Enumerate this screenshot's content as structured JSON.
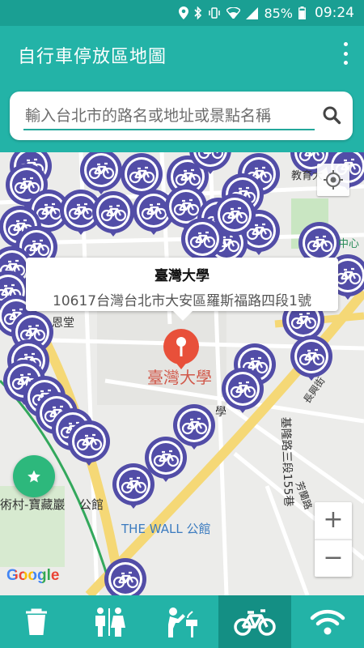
{
  "status_bar": {
    "battery": "85%",
    "time": "09:24"
  },
  "app_bar": {
    "title": "自行車停放區地圖"
  },
  "search": {
    "placeholder": "輸入台北市的路名或地址或景點名稱"
  },
  "map": {
    "selected_place": {
      "name": "臺灣大學",
      "address": "10617台灣台北市大安區羅斯福路四段1號"
    },
    "marker_label": "臺灣大學",
    "labels": {
      "keelung_rd": "基隆路三段155巷",
      "art_village": "術村-寶藏巖",
      "park": "公館",
      "the_wall": "THE WALL 公館",
      "fangming": "芳蘭路",
      "xinglong": "長興街",
      "edu": "教育大",
      "center": "中心",
      "hall": "恩堂",
      "xue": "學"
    },
    "zoom_in": "+",
    "zoom_out": "−",
    "attribution": "Google"
  },
  "bottom_nav": {
    "items": [
      {
        "name": "trash",
        "icon": "trash-can-icon"
      },
      {
        "name": "restroom",
        "icon": "restroom-icon"
      },
      {
        "name": "drinking-water",
        "icon": "drinking-fountain-icon"
      },
      {
        "name": "bicycle",
        "icon": "bicycle-icon",
        "active": true
      },
      {
        "name": "wifi",
        "icon": "wifi-icon"
      }
    ]
  },
  "colors": {
    "primary": "#23b3a7",
    "primary_dark": "#1a9f93",
    "active_tab": "#148f84",
    "bike_marker": "#524da7",
    "place_marker": "#e8503a",
    "fab": "#2db87c"
  }
}
